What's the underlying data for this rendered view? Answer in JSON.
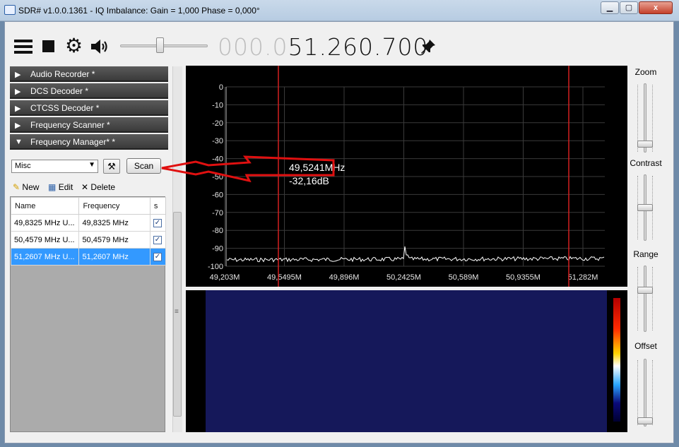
{
  "window": {
    "title": "SDR# v1.0.0.1361 - IQ Imbalance: Gain = 1,000 Phase = 0,000°",
    "min_glyph": "▁",
    "max_glyph": "▢",
    "close_glyph": "x"
  },
  "toolbar": {
    "frequency_dim": "000.0",
    "frequency_main": "51.260.700",
    "volume_level": 0.45
  },
  "panels": [
    {
      "label": "Audio Recorder *",
      "expanded": false
    },
    {
      "label": "DCS Decoder *",
      "expanded": false
    },
    {
      "label": "CTCSS Decoder *",
      "expanded": false
    },
    {
      "label": "Frequency Scanner *",
      "expanded": false
    },
    {
      "label": "Frequency Manager* *",
      "expanded": true
    }
  ],
  "frequency_manager": {
    "group_value": "Misc",
    "scan_label": "Scan",
    "new_label": "New",
    "edit_label": "Edit",
    "delete_label": "Delete",
    "columns": [
      "Name",
      "Frequency",
      "s"
    ],
    "rows": [
      {
        "name": "49,8325 MHz U...",
        "frequency": "49,8325 MHz",
        "checked": true,
        "selected": false
      },
      {
        "name": "50,4579 MHz U...",
        "frequency": "50,4579 MHz",
        "checked": true,
        "selected": false
      },
      {
        "name": "51,2607 MHz U...",
        "frequency": "51,2607 MHz",
        "checked": true,
        "selected": true
      }
    ]
  },
  "right_panel": {
    "zoom_label": "Zoom",
    "contrast_label": "Contrast",
    "range_label": "Range",
    "offset_label": "Offset"
  },
  "spectrum": {
    "y_ticks": [
      "0",
      "-10",
      "-20",
      "-30",
      "-40",
      "-50",
      "-60",
      "-70",
      "-80",
      "-90",
      "-100"
    ],
    "x_ticks": [
      "49,203M",
      "49,5495M",
      "49,896M",
      "50,2425M",
      "50,589M",
      "50,9355M",
      "51,282M"
    ],
    "cursor_freq": "49,5241MHz",
    "cursor_db": "-32,16dB",
    "colors": {
      "background": "#000000",
      "grid": "#3a3a3a",
      "trace": "#ffffff",
      "markers": "#d42020",
      "waterfall": "#15185a"
    }
  },
  "annotation": {
    "color": "#e01010"
  }
}
